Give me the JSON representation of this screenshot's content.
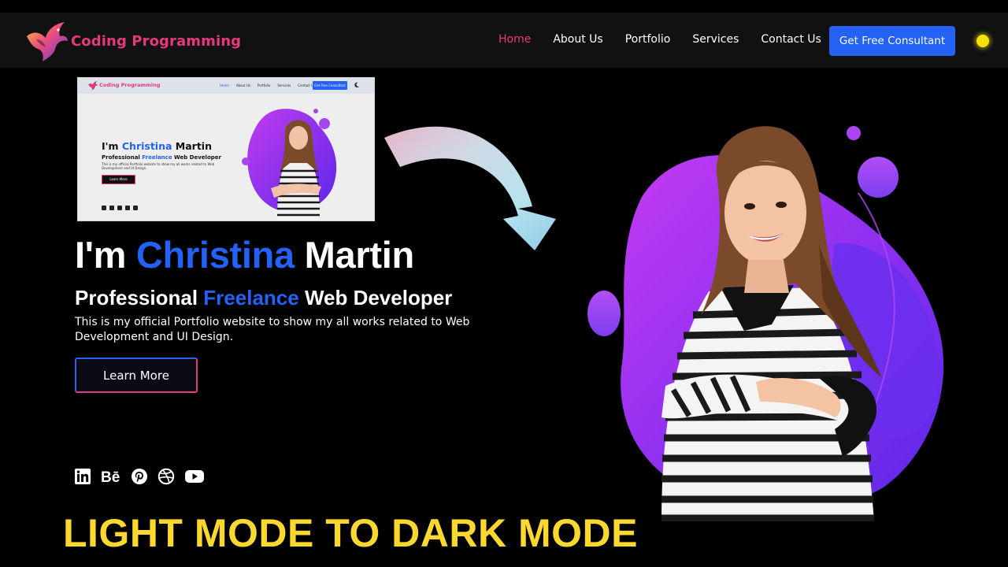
{
  "colors": {
    "accent_pink": "#e5387f",
    "accent_blue": "#2461f5",
    "caption_yellow": "#fbd82f",
    "blob_purple": "#9b30f0",
    "background": "#000000"
  },
  "brand": {
    "name": "Coding Programming",
    "logo_icon": "phoenix-bird-logo"
  },
  "nav": {
    "items": [
      {
        "label": "Home",
        "active": true
      },
      {
        "label": "About Us",
        "active": false
      },
      {
        "label": "Portfolio",
        "active": false
      },
      {
        "label": "Services",
        "active": false
      },
      {
        "label": "Contact Us",
        "active": false
      }
    ],
    "cta_label": "Get Free Consultant",
    "theme_toggle_icon": "sun-icon"
  },
  "light_preview": {
    "brand": "Coding Programming",
    "nav_items": [
      "Home",
      "About Us",
      "Portfolio",
      "Services",
      "Contact Us"
    ],
    "cta_label": "Get Free Consultant",
    "theme_toggle_icon": "moon-icon",
    "headline_prefix": "I'm",
    "headline_name": "Christina",
    "headline_suffix": "Martin",
    "subhead_prefix": "Professional",
    "subhead_highlight": "Freelance",
    "subhead_suffix": "Web Developer",
    "description": "This is my official Portfolio website to show my all works related to Web Development and UI Design.",
    "button_label": "Learn More"
  },
  "hero": {
    "headline_prefix": "I'm",
    "headline_name": "Christina",
    "headline_suffix": "Martin",
    "subhead_prefix": "Professional",
    "subhead_highlight": "Freelance",
    "subhead_suffix": "Web Developer",
    "description": "This is my official Portfolio website to show my all works related to Web Development and UI Design.",
    "button_label": "Learn More"
  },
  "socials": [
    {
      "icon": "linkedin-icon",
      "label": "in"
    },
    {
      "icon": "behance-icon",
      "label": "Bē"
    },
    {
      "icon": "pinterest-icon",
      "label": "P"
    },
    {
      "icon": "dribbble-icon",
      "label": ""
    },
    {
      "icon": "youtube-icon",
      "label": ""
    }
  ],
  "caption": "LIGHT MODE TO DARK MODE"
}
